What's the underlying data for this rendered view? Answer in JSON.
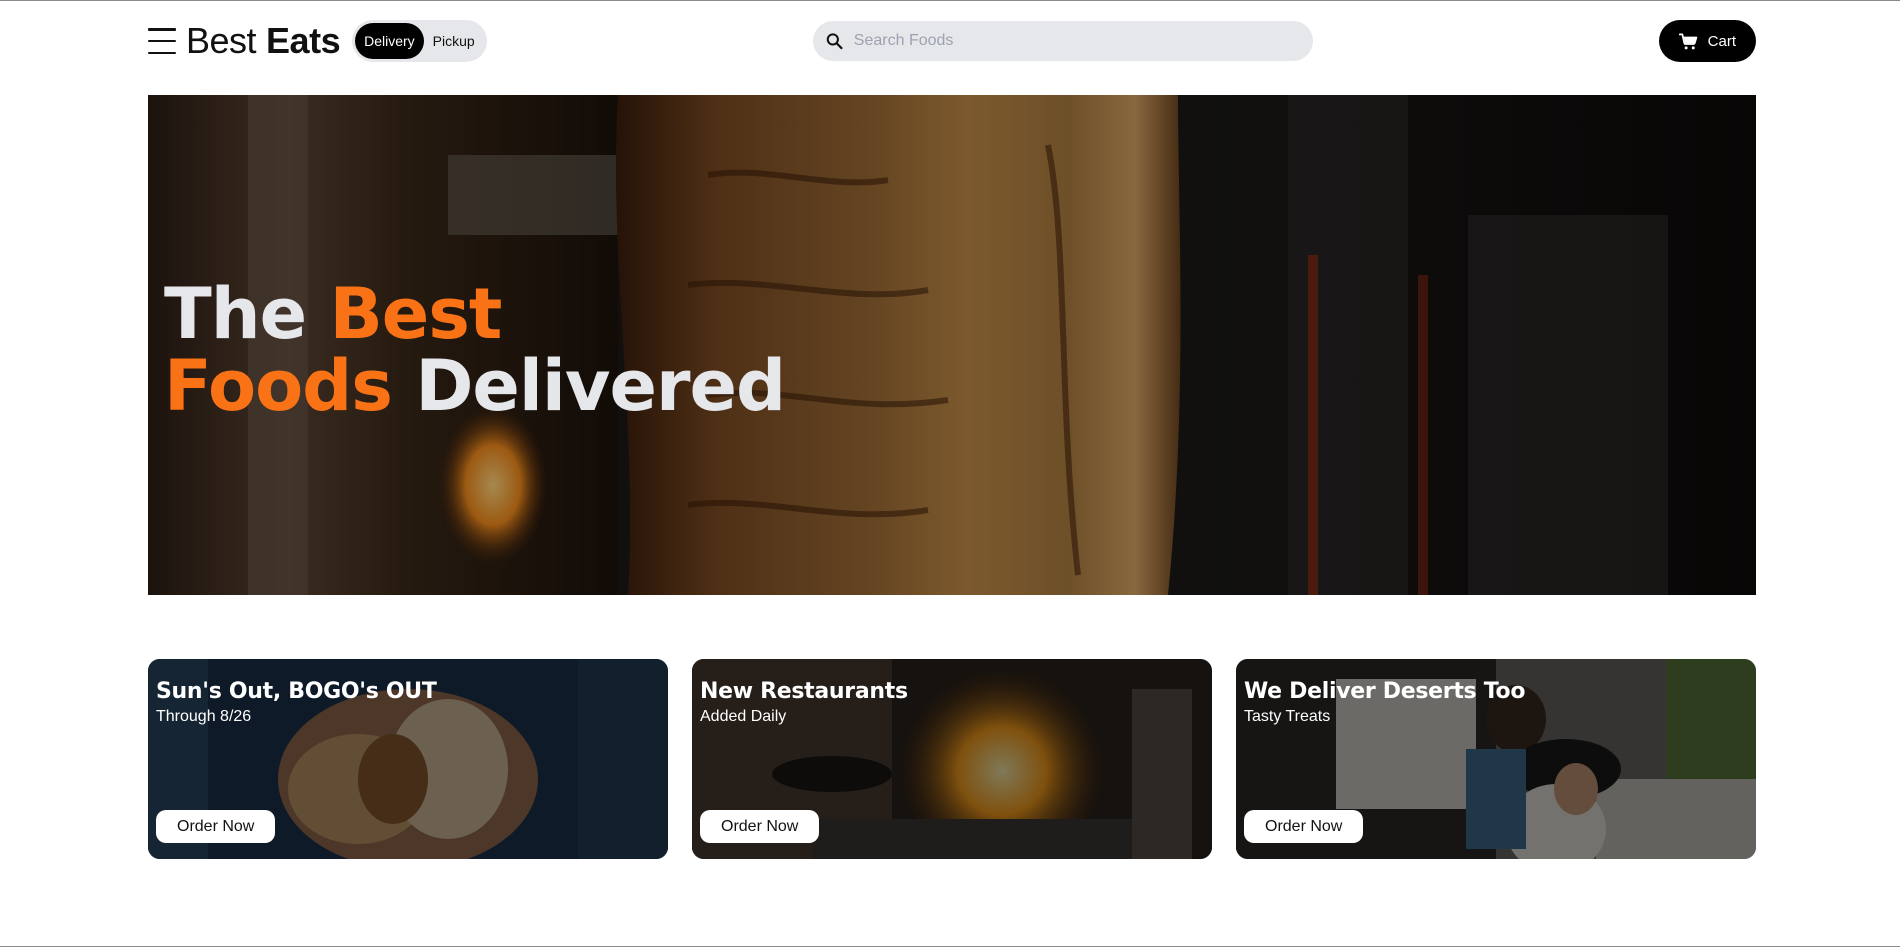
{
  "header": {
    "logo_light": "Best",
    "logo_bold": "Eats",
    "modes": [
      {
        "label": "Delivery",
        "active": true
      },
      {
        "label": "Pickup",
        "active": false
      }
    ],
    "search_placeholder": "Search Foods",
    "cart_label": "Cart"
  },
  "hero": {
    "word1": "The",
    "word2": "Best",
    "word3": "Foods",
    "word4": "Delivered",
    "accent_color": "#f97316"
  },
  "cards": [
    {
      "title": "Sun's Out, BOGO's OUT",
      "subtitle": "Through 8/26",
      "button": "Order Now"
    },
    {
      "title": "New Restaurants",
      "subtitle": "Added Daily",
      "button": "Order Now"
    },
    {
      "title": "We Deliver Deserts Too",
      "subtitle": "Tasty Treats",
      "button": "Order Now"
    }
  ]
}
